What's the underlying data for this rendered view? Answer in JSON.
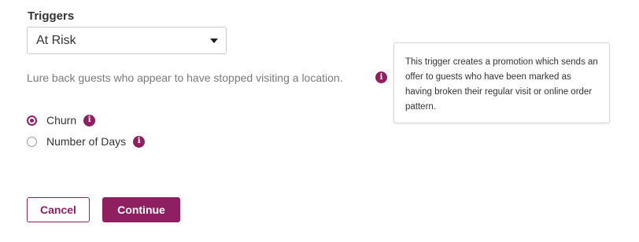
{
  "section": {
    "label": "Triggers"
  },
  "trigger_select": {
    "value": "At Risk",
    "icon": "chevron-down-icon"
  },
  "description": {
    "text": "Lure back guests who appear to have stopped visiting a location.",
    "icon": "info-icon"
  },
  "tooltip": {
    "text": "This trigger creates a promotion which sends an offer to guests who have been marked as having broken their regular visit or online order pattern."
  },
  "radio_options": [
    {
      "label": "Churn",
      "checked": true,
      "icon": "info-icon"
    },
    {
      "label": "Number of Days",
      "checked": false,
      "icon": "info-icon"
    }
  ],
  "actions": {
    "cancel_label": "Cancel",
    "continue_label": "Continue"
  },
  "colors": {
    "accent": "#8e2062",
    "muted_text": "#7a7a7a",
    "border": "#c9c9c9"
  }
}
